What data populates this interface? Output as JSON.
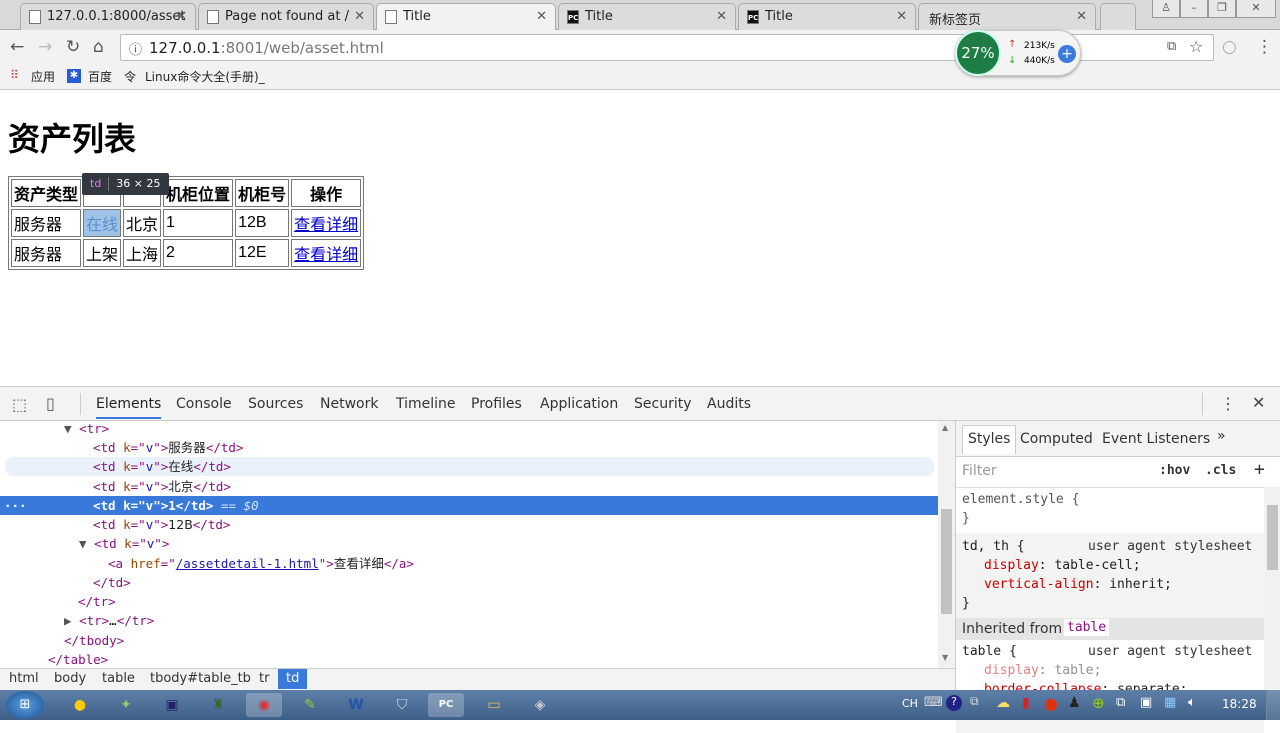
{
  "browser": {
    "tabs": [
      {
        "title": "127.0.0.1:8000/asset",
        "icon": "page-icon"
      },
      {
        "title": "Page not found at /",
        "icon": "page-icon"
      },
      {
        "title": "Title",
        "icon": "page-icon",
        "active": true
      },
      {
        "title": "Title",
        "icon": "pycharm-icon"
      },
      {
        "title": "Title",
        "icon": "pycharm-icon"
      },
      {
        "title": "新标签页",
        "icon": "none"
      }
    ],
    "url_host": "127.0.0.1",
    "url_rest": ":8001/web/asset.html",
    "bookmarks": [
      {
        "label": "应用",
        "icon": "apps-grid-icon"
      },
      {
        "label": "百度",
        "icon": "baidu-paw-icon"
      },
      {
        "label": "Linux命令大全(手册)_",
        "icon": "linux-icon"
      }
    ],
    "net_widget": {
      "percent": "27%",
      "upload": "213K/s",
      "download": "440K/s"
    }
  },
  "page": {
    "title": "资产列表",
    "table": {
      "headers": [
        "资产类型",
        "",
        "",
        "机柜位置",
        "机柜号",
        "操作"
      ],
      "rows": [
        [
          "服务器",
          "在线",
          "北京",
          "1",
          "12B",
          "查看详细"
        ],
        [
          "服务器",
          "上架",
          "上海",
          "2",
          "12E",
          "查看详细"
        ]
      ]
    },
    "tooltip": {
      "tag": "td",
      "size": "36 × 25"
    }
  },
  "devtools": {
    "tabs": [
      "Elements",
      "Console",
      "Sources",
      "Network",
      "Timeline",
      "Profiles",
      "Application",
      "Security",
      "Audits"
    ],
    "dom": {
      "tr_open": "<tr>",
      "td1_text": "服务器",
      "td2_text": "在线",
      "td3_text": "北京",
      "td4_text": "1",
      "td5_text": "12B",
      "href": "/assetdetail-1.html",
      "link_text": "查看详细",
      "selected_suffix": " == $0",
      "collapsed_tr": "…"
    },
    "breadcrumbs": [
      "html",
      "body",
      "table",
      "tbody#table_tb",
      "tr",
      "td"
    ],
    "styles": {
      "tabs": [
        "Styles",
        "Computed",
        "Event Listeners",
        "»"
      ],
      "filter_placeholder": "Filter",
      "hov": ":hov",
      "cls": ".cls",
      "add": "+",
      "element_style": "element.style {",
      "close": "}",
      "rule1_selector": "td, th {",
      "rule1_source": "user agent stylesheet",
      "rule1_props": [
        [
          "display",
          "table-cell;"
        ],
        [
          "vertical-align",
          "inherit;"
        ]
      ],
      "inherited_label": "Inherited from",
      "inherited_tag": "table",
      "rule2_selector": "table {",
      "rule2_source": "user agent stylesheet",
      "rule2_props": [
        [
          "display",
          "table;"
        ],
        [
          "border-collapse",
          "separate;"
        ]
      ]
    }
  },
  "taskbar": {
    "clock": "18:28",
    "lang": "CH"
  }
}
